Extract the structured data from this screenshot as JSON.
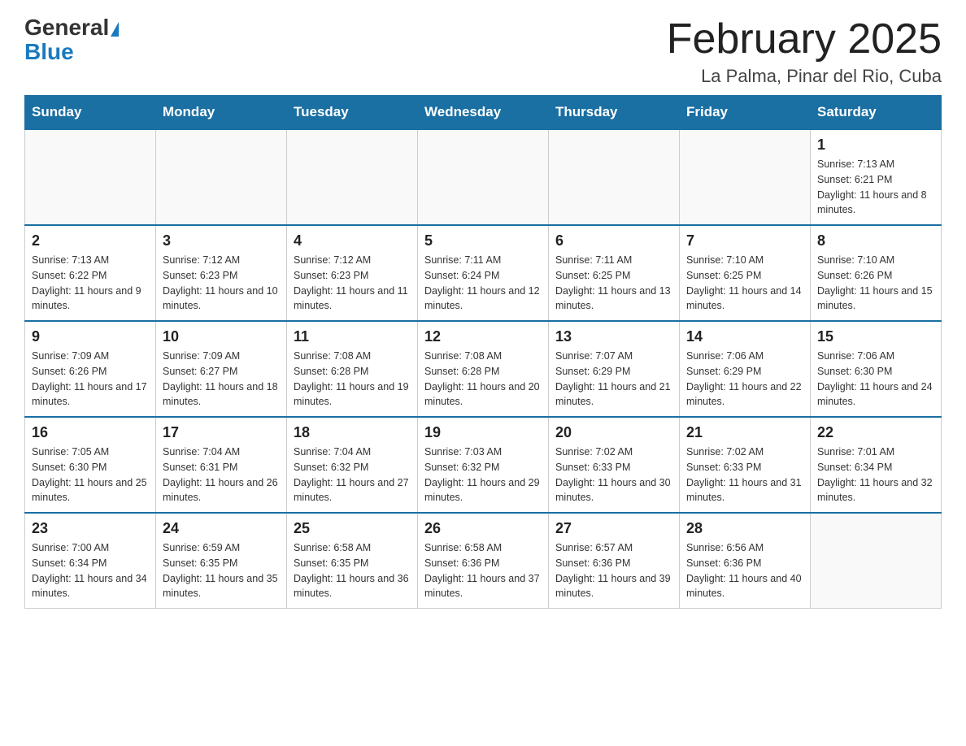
{
  "header": {
    "logo_general": "General",
    "logo_blue": "Blue",
    "month_title": "February 2025",
    "location": "La Palma, Pinar del Rio, Cuba"
  },
  "weekdays": [
    "Sunday",
    "Monday",
    "Tuesday",
    "Wednesday",
    "Thursday",
    "Friday",
    "Saturday"
  ],
  "weeks": [
    [
      {
        "day": "",
        "info": ""
      },
      {
        "day": "",
        "info": ""
      },
      {
        "day": "",
        "info": ""
      },
      {
        "day": "",
        "info": ""
      },
      {
        "day": "",
        "info": ""
      },
      {
        "day": "",
        "info": ""
      },
      {
        "day": "1",
        "info": "Sunrise: 7:13 AM\nSunset: 6:21 PM\nDaylight: 11 hours and 8 minutes."
      }
    ],
    [
      {
        "day": "2",
        "info": "Sunrise: 7:13 AM\nSunset: 6:22 PM\nDaylight: 11 hours and 9 minutes."
      },
      {
        "day": "3",
        "info": "Sunrise: 7:12 AM\nSunset: 6:23 PM\nDaylight: 11 hours and 10 minutes."
      },
      {
        "day": "4",
        "info": "Sunrise: 7:12 AM\nSunset: 6:23 PM\nDaylight: 11 hours and 11 minutes."
      },
      {
        "day": "5",
        "info": "Sunrise: 7:11 AM\nSunset: 6:24 PM\nDaylight: 11 hours and 12 minutes."
      },
      {
        "day": "6",
        "info": "Sunrise: 7:11 AM\nSunset: 6:25 PM\nDaylight: 11 hours and 13 minutes."
      },
      {
        "day": "7",
        "info": "Sunrise: 7:10 AM\nSunset: 6:25 PM\nDaylight: 11 hours and 14 minutes."
      },
      {
        "day": "8",
        "info": "Sunrise: 7:10 AM\nSunset: 6:26 PM\nDaylight: 11 hours and 15 minutes."
      }
    ],
    [
      {
        "day": "9",
        "info": "Sunrise: 7:09 AM\nSunset: 6:26 PM\nDaylight: 11 hours and 17 minutes."
      },
      {
        "day": "10",
        "info": "Sunrise: 7:09 AM\nSunset: 6:27 PM\nDaylight: 11 hours and 18 minutes."
      },
      {
        "day": "11",
        "info": "Sunrise: 7:08 AM\nSunset: 6:28 PM\nDaylight: 11 hours and 19 minutes."
      },
      {
        "day": "12",
        "info": "Sunrise: 7:08 AM\nSunset: 6:28 PM\nDaylight: 11 hours and 20 minutes."
      },
      {
        "day": "13",
        "info": "Sunrise: 7:07 AM\nSunset: 6:29 PM\nDaylight: 11 hours and 21 minutes."
      },
      {
        "day": "14",
        "info": "Sunrise: 7:06 AM\nSunset: 6:29 PM\nDaylight: 11 hours and 22 minutes."
      },
      {
        "day": "15",
        "info": "Sunrise: 7:06 AM\nSunset: 6:30 PM\nDaylight: 11 hours and 24 minutes."
      }
    ],
    [
      {
        "day": "16",
        "info": "Sunrise: 7:05 AM\nSunset: 6:30 PM\nDaylight: 11 hours and 25 minutes."
      },
      {
        "day": "17",
        "info": "Sunrise: 7:04 AM\nSunset: 6:31 PM\nDaylight: 11 hours and 26 minutes."
      },
      {
        "day": "18",
        "info": "Sunrise: 7:04 AM\nSunset: 6:32 PM\nDaylight: 11 hours and 27 minutes."
      },
      {
        "day": "19",
        "info": "Sunrise: 7:03 AM\nSunset: 6:32 PM\nDaylight: 11 hours and 29 minutes."
      },
      {
        "day": "20",
        "info": "Sunrise: 7:02 AM\nSunset: 6:33 PM\nDaylight: 11 hours and 30 minutes."
      },
      {
        "day": "21",
        "info": "Sunrise: 7:02 AM\nSunset: 6:33 PM\nDaylight: 11 hours and 31 minutes."
      },
      {
        "day": "22",
        "info": "Sunrise: 7:01 AM\nSunset: 6:34 PM\nDaylight: 11 hours and 32 minutes."
      }
    ],
    [
      {
        "day": "23",
        "info": "Sunrise: 7:00 AM\nSunset: 6:34 PM\nDaylight: 11 hours and 34 minutes."
      },
      {
        "day": "24",
        "info": "Sunrise: 6:59 AM\nSunset: 6:35 PM\nDaylight: 11 hours and 35 minutes."
      },
      {
        "day": "25",
        "info": "Sunrise: 6:58 AM\nSunset: 6:35 PM\nDaylight: 11 hours and 36 minutes."
      },
      {
        "day": "26",
        "info": "Sunrise: 6:58 AM\nSunset: 6:36 PM\nDaylight: 11 hours and 37 minutes."
      },
      {
        "day": "27",
        "info": "Sunrise: 6:57 AM\nSunset: 6:36 PM\nDaylight: 11 hours and 39 minutes."
      },
      {
        "day": "28",
        "info": "Sunrise: 6:56 AM\nSunset: 6:36 PM\nDaylight: 11 hours and 40 minutes."
      },
      {
        "day": "",
        "info": ""
      }
    ]
  ]
}
